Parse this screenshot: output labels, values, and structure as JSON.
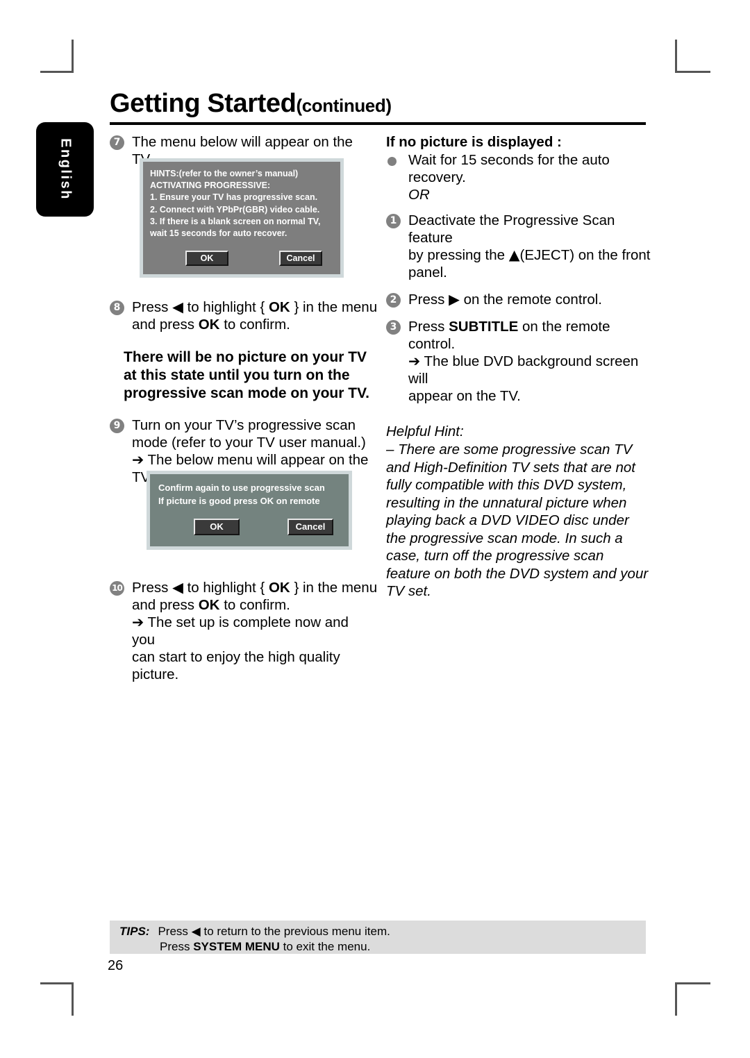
{
  "sidebar": {
    "language_tab": "English"
  },
  "header": {
    "title": "Getting Started",
    "continued": "(continued)"
  },
  "left_column": {
    "step7": {
      "num": "7",
      "text": "The menu below will appear on the TV."
    },
    "dialog1": {
      "lines": [
        "HINTS:(refer to the owner’s manual)",
        "ACTIVATING PROGRESSIVE:",
        "1. Ensure your TV has progressive scan.",
        "2. Connect with YPbPr(GBR) video cable.",
        "3. If there is a blank screen on normal TV,",
        "    wait 15 seconds for auto recover."
      ],
      "ok_label": "OK",
      "cancel_label": "Cancel"
    },
    "step8": {
      "num": "8",
      "pre": "Press",
      "arrow": "◀",
      "mid": "to highlight {",
      "ok": "OK",
      "post": "} in the menu",
      "line2_pre": "and press",
      "line2_ok": "OK",
      "line2_post": "to confirm."
    },
    "warning": "There will be no picture on your TV at this state until you turn on the progressive scan mode on your TV.",
    "step9": {
      "num": "9",
      "line1": "Turn on your TV’s progressive scan",
      "line2": "mode (refer to your TV user manual.)",
      "arrow": "➔",
      "line3": "The below menu will appear on the",
      "line4": "TV."
    },
    "dialog2": {
      "lines": [
        "Confirm again to use progressive scan",
        "If picture is good press OK on remote"
      ],
      "ok_label": "OK",
      "cancel_label": "Cancel"
    },
    "step10": {
      "num": "10",
      "pre": "Press",
      "arrow": "◀",
      "mid": "to highlight {",
      "ok": "OK",
      "post": "} in the menu",
      "line2_pre": "and press",
      "line2_ok": "OK",
      "line2_post": "to confirm.",
      "result_arrow": "➔",
      "result_line1": "The set up is complete now and you",
      "result_line2": "can start to enjoy the high quality picture."
    }
  },
  "right_column": {
    "heading": "If no picture is displayed :",
    "bullet": {
      "line1": "Wait for 15 seconds for the auto",
      "line2": "recovery.",
      "line3": "OR"
    },
    "step1": {
      "num": "1",
      "line1": "Deactivate the Progressive Scan feature",
      "line2_pre": "by pressing the",
      "eject_icon": "▲",
      "line2_post": "(EJECT) on the front",
      "line3": "panel."
    },
    "step2": {
      "num": "2",
      "pre": "Press",
      "arrow": "▶",
      "post": "on the remote control."
    },
    "step3": {
      "num": "3",
      "pre": "Press",
      "key": "SUBTITLE",
      "post": "on the remote",
      "line2": "control.",
      "result_arrow": "➔",
      "result_line1": "The blue DVD background screen will",
      "result_line2": "appear on the TV."
    },
    "helpful_hint_title": "Helpful Hint:",
    "helpful_hint_body": "– There are some progressive scan TV and High-Definition TV sets that are not fully compatible with this DVD system, resulting in the unnatural picture when playing back a DVD VIDEO disc under the progressive scan mode.  In such a case, turn off the progressive scan feature on both the DVD system and your TV set."
  },
  "footer": {
    "tips_label": "TIPS:",
    "tips_line1_pre": "Press",
    "tips_line1_arrow": "◀",
    "tips_line1_post": "to return to the previous menu item.",
    "tips_line2_pre": "Press",
    "tips_line2_key": "SYSTEM MENU",
    "tips_line2_post": "to exit the menu.",
    "page_number": "26"
  },
  "colors": {
    "tab_background": "#000000",
    "dialog1_background": "#7e7e7e",
    "dialog2_background": "#74837f",
    "dialog_border": "#cfd8da",
    "step_circle": "#818181",
    "tips_background": "#dcdcdc"
  }
}
